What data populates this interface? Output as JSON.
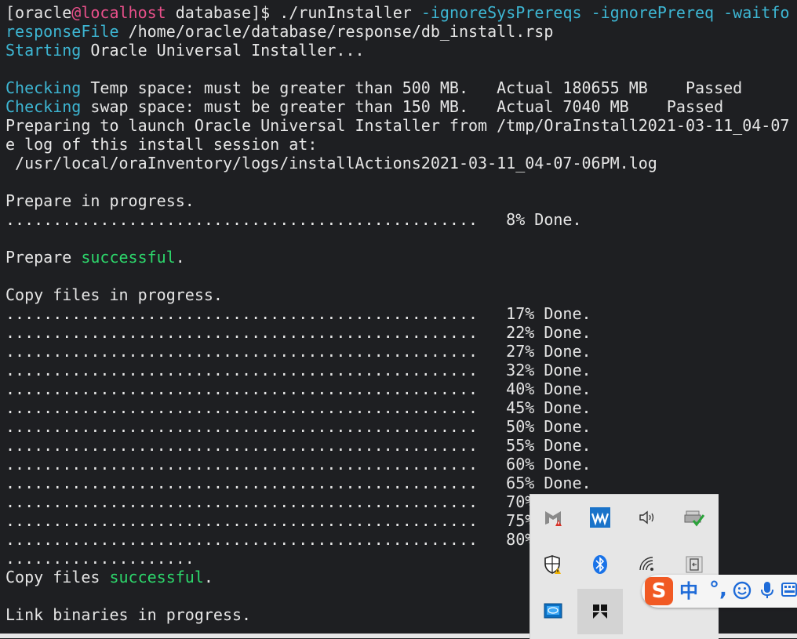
{
  "terminal": {
    "prompt": {
      "user": "[oracle",
      "at": "@",
      "host": "localhost",
      "rest": " database]$ ./runInstaller ",
      "flags1": "-ignoreSysPrereqs -ignorePrereq -waitfo",
      "flags2": "responseFile",
      "rest2": " /home/oracle/database/response/db_install.rsp"
    },
    "starting": {
      "word": "Starting",
      "rest": " Oracle Universal Installer..."
    },
    "check_temp": {
      "word": "Checking",
      "rest": " Temp space: must be greater than 500 MB.   Actual 180655 MB    Passed"
    },
    "check_swap": {
      "word": "Checking",
      "rest": " swap space: must be greater than 150 MB.   Actual 7040 MB    Passed"
    },
    "preparing": "Preparing to launch Oracle Universal Installer from /tmp/OraInstall2021-03-11_04-07",
    "log_intro": "e log of this install session at:",
    "log_path": " /usr/local/oraInventory/logs/installActions2021-03-11_04-07-06PM.log",
    "prepare_progress": "Prepare in progress.",
    "prepare_bar": "..................................................   8% Done.",
    "prepare_ok": {
      "word": "Prepare",
      "status": "successful",
      "end": "."
    },
    "copy_progress": "Copy files in progress.",
    "copy_bars": [
      "..................................................   17% Done.",
      "..................................................   22% Done.",
      "..................................................   27% Done.",
      "..................................................   32% Done.",
      "..................................................   40% Done.",
      "..................................................   45% Done.",
      "..................................................   50% Done.",
      "..................................................   55% Done.",
      "..................................................   60% Done.",
      "..................................................   65% Done.",
      "..................................................   70%",
      "..................................................   75%",
      "..................................................   80%"
    ],
    "copy_tail": "....................",
    "copy_ok": {
      "word": "Copy files",
      "status": "successful",
      "end": "."
    },
    "link_progress": "Link binaries in progress."
  },
  "tray": {
    "icons": [
      "mcafee-icon",
      "waves-audio-icon",
      "volume-icon",
      "printer-ok-icon",
      "defender-shield-icon",
      "bluetooth-icon",
      "wifi-icon",
      "usb-eject-icon",
      "intel-graphics-icon",
      "app-black-icon"
    ]
  },
  "ime": {
    "logo": "S",
    "lang": "中",
    "punct": "°,"
  },
  "colors": {
    "background": "#1e1f22",
    "text": "#e6e6e6",
    "cyan": "#3db6d3",
    "pink": "#e8508a",
    "green": "#2dd66b",
    "tray": "#e6e6e6",
    "ime_orange": "#f15a24",
    "ime_blue": "#1e6bd8"
  }
}
